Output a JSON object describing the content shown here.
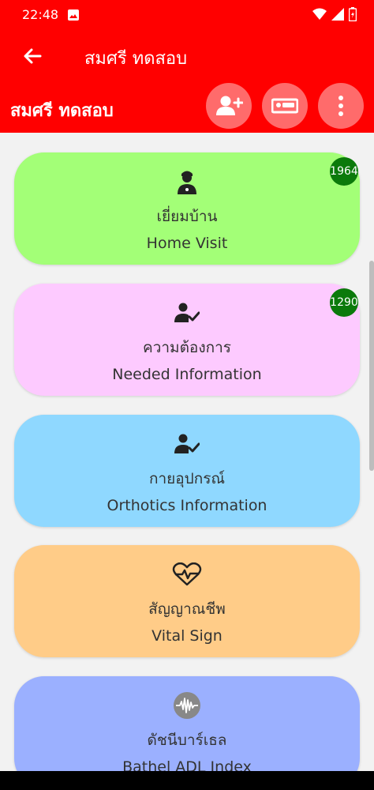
{
  "status": {
    "time": "22:48"
  },
  "appbar": {
    "title": "สมศรี ทดสอบ"
  },
  "header": {
    "name": "สมศรี ทดสอบ"
  },
  "cards": [
    {
      "thai": "เยี่ยมบ้าน",
      "english": "Home Visit",
      "badge": "1964",
      "color": "#a3ff77",
      "icon": "nurse-icon"
    },
    {
      "thai": "ความต้องการ",
      "english": "Needed Information",
      "badge": "1290",
      "color": "#fdcaff",
      "icon": "person-check-icon"
    },
    {
      "thai": "กายอุปกรณ์",
      "english": "Orthotics Information",
      "color": "#8fd8ff",
      "icon": "person-check-icon"
    },
    {
      "thai": "สัญญาณชีพ",
      "english": "Vital Sign",
      "color": "#ffcc88",
      "icon": "heartbeat-icon"
    },
    {
      "thai": "ดัชนีบาร์เธล",
      "english": "Bathel ADL Index",
      "color": "#9bb0ff",
      "icon": "waveform-icon"
    }
  ],
  "colors": {
    "primary": "#ff0000",
    "action_button": "#ff6b6b",
    "badge": "#0b7a0b"
  }
}
